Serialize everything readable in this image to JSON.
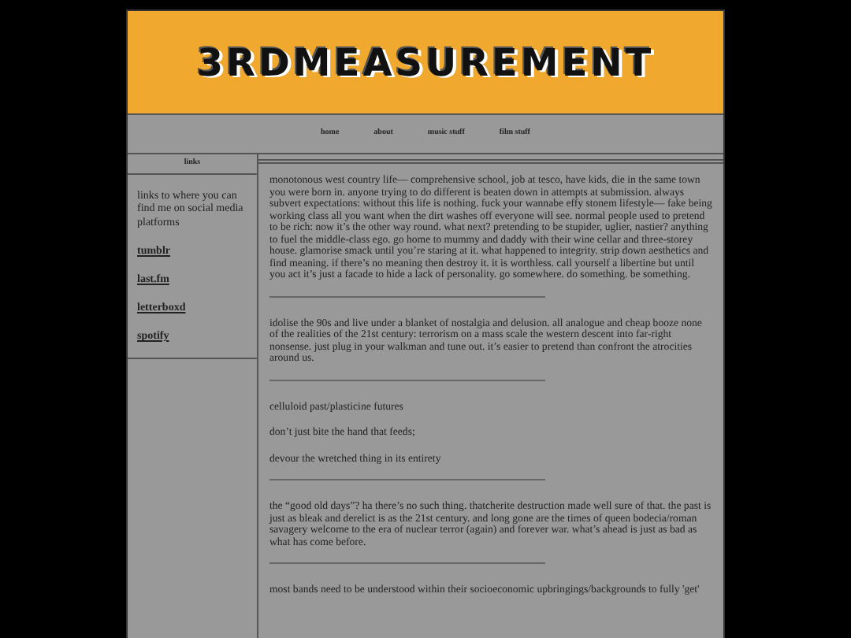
{
  "header": {
    "title": "3RDMEASUREMENT"
  },
  "nav": [
    {
      "label": "home"
    },
    {
      "label": "about"
    },
    {
      "label": "music stuff"
    },
    {
      "label": "film stuff"
    }
  ],
  "sidebar": {
    "heading": "links",
    "intro": "links to where you can find me on social media platforms",
    "links": [
      {
        "label": "tumblr"
      },
      {
        "label": "last.fm"
      },
      {
        "label": "letterboxd"
      },
      {
        "label": "spotify"
      }
    ]
  },
  "main": {
    "blocks": [
      {
        "kind": "paragraph",
        "text": "monotonous west country life— comprehensive school, job at tesco, have kids, die in the same town you were born in. anyone trying to do different is beaten down in attempts at submission. always subvert expectations: without this life is nothing. fuck your wannabe effy stonem lifestyle— fake being working class all you want when the dirt washes off everyone will see. normal people used to pretend to be rich: now it’s the other way round. what next? pretending to be stupider, uglier, nastier? anything to fuel the middle-class ego. go home to mummy and daddy with their wine cellar and three-storey house. glamorise smack until you’re staring at it. what happened to integrity. strip down aesthetics and find meaning. if there’s no meaning then destroy it. it is worthless. call yourself a libertine but until you act it’s just a facade to hide a lack of personality. go somewhere. do something. be something."
      },
      {
        "kind": "rule"
      },
      {
        "kind": "paragraph",
        "text": "idolise the 90s and live under a blanket of nostalgia and delusion. all analogue and cheap booze none of the realities of the 21st century: terrorism on a mass scale the western descent into far-right nonsense. just plug in your walkman and tune out. it’s easier to pretend than confront the atrocities around us."
      },
      {
        "kind": "rule"
      },
      {
        "kind": "paragraph",
        "text": "celluloid past/plasticine futures"
      },
      {
        "kind": "paragraph",
        "text": "don’t just bite the hand that feeds;"
      },
      {
        "kind": "paragraph",
        "text": "devour the wretched thing in its entirety"
      },
      {
        "kind": "rule"
      },
      {
        "kind": "paragraph",
        "text": "the “good old days”? ha there’s no such thing. thatcherite destruction made well sure of that. the past is just as bleak and derelict is as the 21st century. and long gone are the times of queen bodecia/roman savagery welcome to the era of nuclear terror (again) and forever war. what’s ahead is just as bad as what has come before."
      },
      {
        "kind": "rule"
      },
      {
        "kind": "paragraph",
        "text": "most bands need to be understood within their socioeconomic upbringings/backgrounds to fully 'get'"
      }
    ]
  }
}
